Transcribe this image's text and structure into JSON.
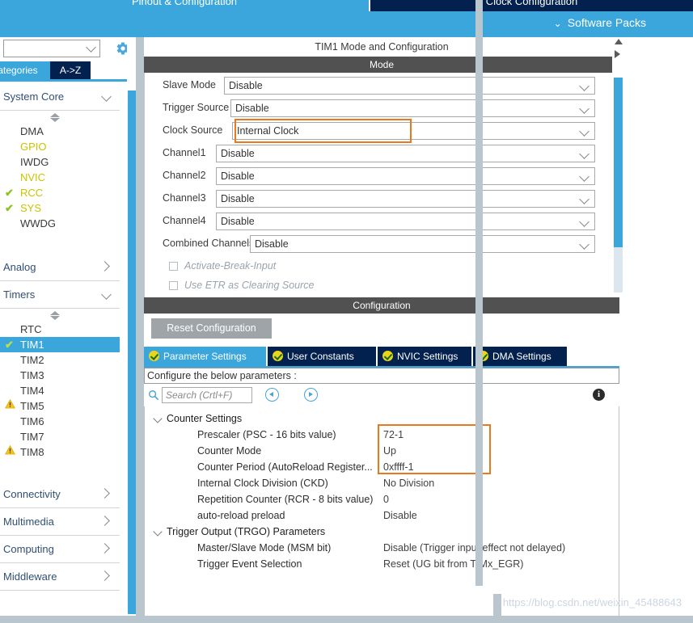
{
  "topbar": {
    "tab_pinout": "Pinout & Configuration",
    "tab_clock": "Clock Configuration",
    "software_packs": "Software Packs",
    "chevron": "⌄"
  },
  "sidebar": {
    "combo_value": "",
    "gear_icon": "gear-icon",
    "tab_categories": "ategories",
    "tab_az": "A->Z",
    "groups": [
      {
        "label": "System Core",
        "expanded": true,
        "items": [
          {
            "label": "DMA",
            "mark": "none",
            "color": "normal"
          },
          {
            "label": "GPIO",
            "mark": "none",
            "color": "yellow"
          },
          {
            "label": "IWDG",
            "mark": "none",
            "color": "normal"
          },
          {
            "label": "NVIC",
            "mark": "none",
            "color": "yellow"
          },
          {
            "label": "RCC",
            "mark": "check",
            "color": "yellow"
          },
          {
            "label": "SYS",
            "mark": "check",
            "color": "yellow"
          },
          {
            "label": "WWDG",
            "mark": "none",
            "color": "normal"
          }
        ]
      },
      {
        "label": "Analog",
        "expanded": false,
        "items": []
      },
      {
        "label": "Timers",
        "expanded": true,
        "items": [
          {
            "label": "RTC",
            "mark": "none",
            "color": "normal"
          },
          {
            "label": "TIM1",
            "mark": "check",
            "color": "normal",
            "selected": true
          },
          {
            "label": "TIM2",
            "mark": "none",
            "color": "normal"
          },
          {
            "label": "TIM3",
            "mark": "none",
            "color": "normal"
          },
          {
            "label": "TIM4",
            "mark": "none",
            "color": "normal"
          },
          {
            "label": "TIM5",
            "mark": "warn",
            "color": "normal"
          },
          {
            "label": "TIM6",
            "mark": "none",
            "color": "normal"
          },
          {
            "label": "TIM7",
            "mark": "none",
            "color": "normal"
          },
          {
            "label": "TIM8",
            "mark": "warn",
            "color": "normal"
          }
        ]
      },
      {
        "label": "Connectivity",
        "expanded": false,
        "items": []
      },
      {
        "label": "Multimedia",
        "expanded": false,
        "items": []
      },
      {
        "label": "Computing",
        "expanded": false,
        "items": []
      },
      {
        "label": "Middleware",
        "expanded": false,
        "items": []
      }
    ]
  },
  "main": {
    "panel_title": "TIM1 Mode and Configuration",
    "mode_header": "Mode",
    "configuration_header": "Configuration",
    "mode_rows": [
      {
        "label": "Slave Mode",
        "value": "Disable"
      },
      {
        "label": "Trigger Source",
        "value": "Disable"
      },
      {
        "label": "Clock Source",
        "value": "Internal Clock",
        "highlighted": true
      },
      {
        "label": "Channel1",
        "value": "Disable"
      },
      {
        "label": "Channel2",
        "value": "Disable"
      },
      {
        "label": "Channel3",
        "value": "Disable"
      },
      {
        "label": "Channel4",
        "value": "Disable"
      },
      {
        "label": "Combined Channels",
        "value": "Disable"
      }
    ],
    "mode_checkboxes": [
      {
        "label": "Activate-Break-Input",
        "checked": false
      },
      {
        "label": "Use ETR as Clearing Source",
        "checked": false
      }
    ]
  },
  "configuration": {
    "reset_button": "Reset Configuration",
    "tabs": [
      {
        "label": "Parameter Settings",
        "active": true
      },
      {
        "label": "User Constants",
        "active": false
      },
      {
        "label": "NVIC Settings",
        "active": false
      },
      {
        "label": "DMA Settings",
        "active": false
      }
    ],
    "note": "Configure the below parameters :",
    "search_placeholder": "Search (Crtl+F)",
    "search_value": "",
    "info_icon": "i",
    "tree": [
      {
        "type": "group",
        "label": "Counter Settings"
      },
      {
        "type": "param",
        "label": "Prescaler (PSC - 16 bits value)",
        "value": "72-1",
        "highlighted": true
      },
      {
        "type": "param",
        "label": "Counter Mode",
        "value": "Up",
        "highlighted": true
      },
      {
        "type": "param",
        "label": "Counter Period (AutoReload Register...",
        "value": "0xffff-1",
        "highlighted": true
      },
      {
        "type": "param",
        "label": "Internal Clock Division (CKD)",
        "value": "No Division"
      },
      {
        "type": "param",
        "label": "Repetition Counter (RCR - 8 bits value)",
        "value": "0"
      },
      {
        "type": "param",
        "label": "auto-reload preload",
        "value": "Disable"
      },
      {
        "type": "group",
        "label": "Trigger Output (TRGO) Parameters"
      },
      {
        "type": "param",
        "label": "Master/Slave Mode (MSM bit)",
        "value": "Disable (Trigger input effect not delayed)"
      },
      {
        "type": "param",
        "label": "Trigger Event Selection",
        "value": "Reset (UG bit from TIMx_EGR)"
      }
    ]
  },
  "watermark": "https://blog.csdn.net/weixin_45488643",
  "colors": {
    "accent_blue": "#3aa6dc",
    "dark_navy": "#03214e",
    "header_grey": "#515151",
    "highlight_orange": "#e8791e",
    "yellow_text": "#c9c400",
    "check_green": "#8fc31f"
  }
}
